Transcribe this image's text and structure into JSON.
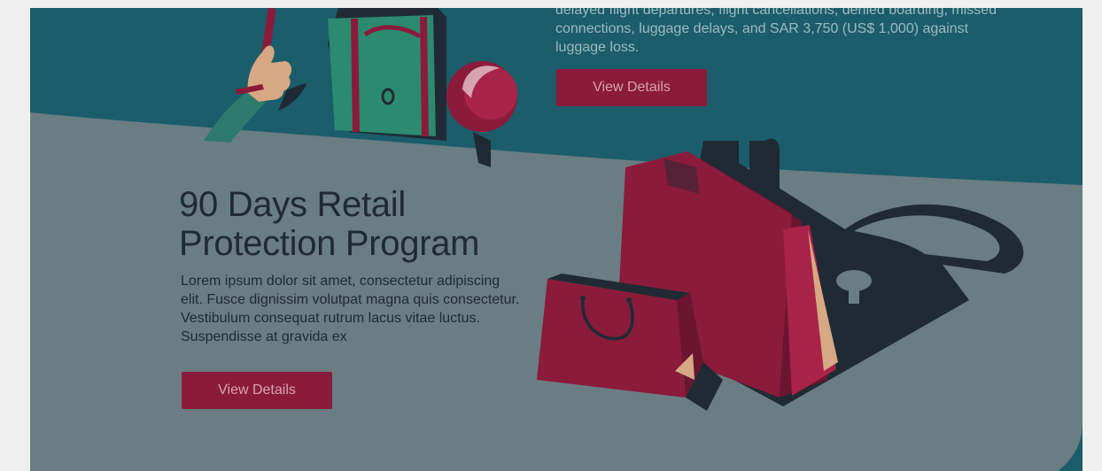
{
  "travel": {
    "description": "delayed flight departures, flight cancellations, denied boarding, missed connections, luggage delays, and SAR 3,750 (US$ 1,000) against luggage loss.",
    "button_label": "View Details"
  },
  "retail": {
    "title": "90 Days Retail Protection Program",
    "description": "Lorem ipsum dolor sit amet, consectetur adipiscing elit. Fusce dignissim volutpat magna quis consectetur. Vestibulum consequat rutrum lacus vitae luctus. Suspendisse at gravida ex",
    "button_label": "View Details"
  },
  "colors": {
    "teal_background": "#1b5d6a",
    "grey_background": "#6a7d82",
    "crimson_accent": "#8b1b3b",
    "dark_navy": "#1f2a34",
    "page_background": "#efefef"
  }
}
